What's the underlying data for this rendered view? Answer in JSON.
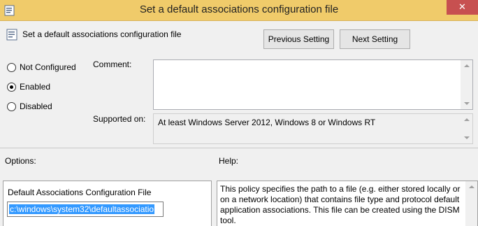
{
  "window": {
    "title": "Set a default associations configuration file",
    "close_glyph": "✕"
  },
  "header": {
    "policy_name": "Set a default associations configuration file",
    "previous_label": "Previous Setting",
    "next_label": "Next Setting"
  },
  "state": {
    "options": [
      {
        "label": "Not Configured",
        "selected": false
      },
      {
        "label": "Enabled",
        "selected": true
      },
      {
        "label": "Disabled",
        "selected": false
      }
    ]
  },
  "comment": {
    "label": "Comment:",
    "value": ""
  },
  "supported": {
    "label": "Supported on:",
    "value": "At least Windows Server 2012, Windows 8 or Windows RT"
  },
  "options_section": {
    "label": "Options:",
    "field_label": "Default Associations Configuration File",
    "field_value": "c:\\windows\\system32\\defaultassociatio"
  },
  "help_section": {
    "label": "Help:",
    "text": "This policy specifies the path to a file (e.g. either stored locally or on a network location) that contains file type and protocol default application associations. This file can be created using the DISM tool."
  },
  "icons": [
    "policy-settings-icon",
    "close-icon",
    "scroll-up-icon",
    "scroll-down-icon"
  ],
  "colors": {
    "titlebar": "#f0cb6a",
    "close": "#c75050",
    "selection": "#3399ff"
  }
}
